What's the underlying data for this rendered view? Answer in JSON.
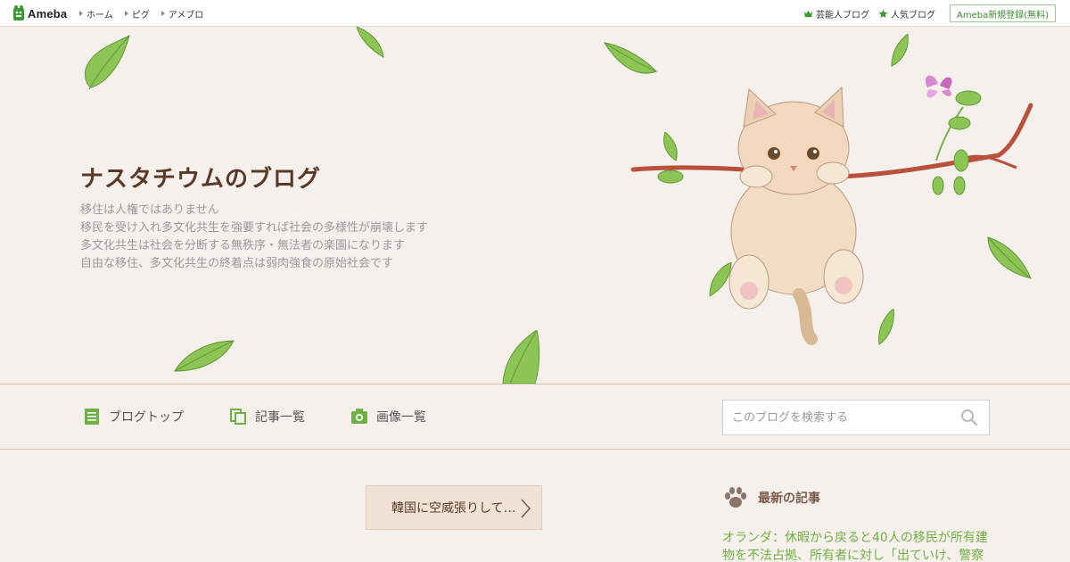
{
  "topbar": {
    "logo_text": "Ameba",
    "nav": [
      "ホーム",
      "ピグ",
      "アメブロ"
    ],
    "celebrity_blog": "芸能人ブログ",
    "popular_blog": "人気ブログ",
    "register": "Ameba新規登録(無料)"
  },
  "header": {
    "title": "ナスタチウムのブログ",
    "description": [
      "移住は人権ではありません",
      "移民を受け入れ多文化共生を強要すれば社会の多様性が崩壊します",
      "多文化共生は社会を分断する無秩序・無法者の楽園になります",
      "自由な移住、多文化共生の終着点は弱肉強食の原始社会です"
    ]
  },
  "nav": {
    "blog_top": "ブログトップ",
    "article_list": "記事一覧",
    "image_list": "画像一覧",
    "search_placeholder": "このブログを検索する"
  },
  "content": {
    "article_link": "韓国に空威張りして…",
    "sidebar_title": "最新の記事",
    "latest_article": "オランダ：休暇から戻ると40人の移民が所有建物を不法占拠、所有者に対し「出ていけ、警察"
  },
  "colors": {
    "accent_green": "#6fb043",
    "brown_title": "#5a3a26",
    "background": "#f6f0ec"
  }
}
